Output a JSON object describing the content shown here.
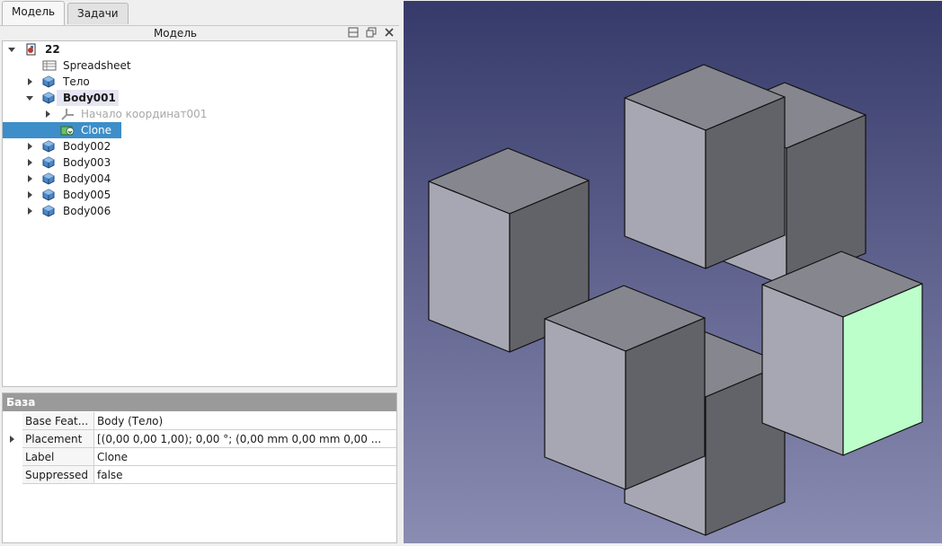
{
  "tabs": [
    {
      "label": "Модель",
      "active": true
    },
    {
      "label": "Задачи",
      "active": false
    }
  ],
  "panel": {
    "title": "Модель"
  },
  "tree": [
    {
      "label": "22",
      "level": 0,
      "expander": "down",
      "icon": "document-icon",
      "style": "bold"
    },
    {
      "label": "Spreadsheet",
      "level": 1,
      "expander": "none",
      "icon": "spreadsheet-icon",
      "style": ""
    },
    {
      "label": "Тело",
      "level": 1,
      "expander": "right",
      "icon": "body-icon",
      "style": ""
    },
    {
      "label": "Body001",
      "level": 1,
      "expander": "down",
      "icon": "body-icon",
      "style": "bold-soft"
    },
    {
      "label": "Начало координат001",
      "level": 2,
      "expander": "right",
      "icon": "origin-icon",
      "style": "faded"
    },
    {
      "label": "Clone",
      "level": 2,
      "expander": "none",
      "icon": "clone-icon",
      "style": "selected"
    },
    {
      "label": "Body002",
      "level": 1,
      "expander": "right",
      "icon": "body-icon",
      "style": ""
    },
    {
      "label": "Body003",
      "level": 1,
      "expander": "right",
      "icon": "body-icon",
      "style": ""
    },
    {
      "label": "Body004",
      "level": 1,
      "expander": "right",
      "icon": "body-icon",
      "style": ""
    },
    {
      "label": "Body005",
      "level": 1,
      "expander": "right",
      "icon": "body-icon",
      "style": ""
    },
    {
      "label": "Body006",
      "level": 1,
      "expander": "right",
      "icon": "body-icon",
      "style": ""
    }
  ],
  "properties": {
    "group": "База",
    "rows": [
      {
        "name": "Base Feat...",
        "value": "Body (Тело)",
        "expandable": false
      },
      {
        "name": "Placement",
        "value": "[(0,00 0,00 1,00); 0,00 °; (0,00 mm  0,00 mm  0,00 ...",
        "expandable": true
      },
      {
        "name": "Label",
        "value": "Clone",
        "expandable": false
      },
      {
        "name": "Suppressed",
        "value": "false",
        "expandable": false
      }
    ]
  },
  "colors": {
    "viewport_top": "#363a6a",
    "viewport_bottom": "#8a8cb2",
    "face_top": "#86868f",
    "face_left": "#a7a7b4",
    "face_right": "#626269",
    "face_selected": "#bcffcb",
    "selection": "#3d8ec9"
  }
}
